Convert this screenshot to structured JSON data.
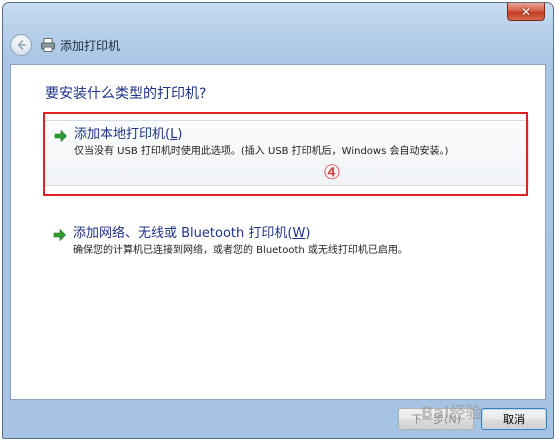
{
  "window": {
    "title": "添加打印机",
    "close_symbol": "✕"
  },
  "icons": {
    "back": "back-arrow-icon",
    "printer": "printer-icon",
    "option_arrow": "green-arrow-icon"
  },
  "colors": {
    "heading_blue": "#1e3287",
    "annotation_red": "#e02222",
    "arrow_green": "#2e9b2e"
  },
  "main": {
    "question": "要安装什么类型的打印机?",
    "options": [
      {
        "title": "添加本地打印机(",
        "hotkey": "L",
        "title_end": ")",
        "description": "仅当没有 USB 打印机时使用此选项。(插入 USB 打印机后，Windows 会自动安装。)"
      },
      {
        "title": "添加网络、无线或 Bluetooth 打印机(",
        "hotkey": "W",
        "title_end": ")",
        "description": "确保您的计算机已连接到网络，或者您的 Bluetooth 或无线打印机已启用。"
      }
    ]
  },
  "annotation": {
    "step_number": "④"
  },
  "buttons": {
    "next": "下一步(N)",
    "cancel": "取消"
  },
  "watermark": "Bai经验"
}
